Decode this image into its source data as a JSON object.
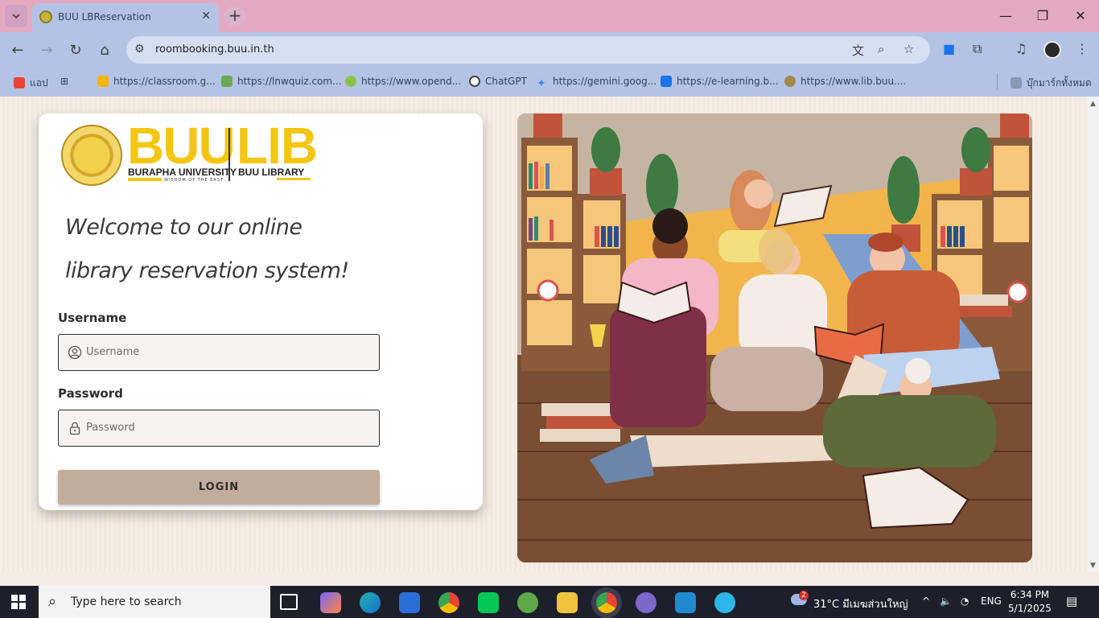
{
  "browser": {
    "tab_title": "BUU LBReservation",
    "url": "roombooking.buu.in.th",
    "bookmarks": [
      {
        "label": "แอป",
        "icon": "apps-icon",
        "color": "#ea4335"
      },
      {
        "label": "https://classroom.g...",
        "icon": "classroom-icon",
        "color": "#f4b400"
      },
      {
        "label": "https://lnwquiz.com...",
        "icon": "lnwquiz-icon",
        "color": "#6aa84f"
      },
      {
        "label": "https://www.opend...",
        "icon": "opend-icon",
        "color": "#8bc34a"
      },
      {
        "label": "ChatGPT",
        "icon": "chatgpt-icon",
        "color": "#444444"
      },
      {
        "label": "https://gemini.goog...",
        "icon": "gemini-icon",
        "color": "#4285f4"
      },
      {
        "label": "https://e-learning.b...",
        "icon": "elearning-icon",
        "color": "#1a73e8"
      },
      {
        "label": "https://www.lib.buu....",
        "icon": "lib-icon",
        "color": "#9e8a4a"
      }
    ],
    "all_bookmarks_label": "บุ๊กมาร์กทั้งหมด"
  },
  "login": {
    "logo_buu": "BUU",
    "logo_buu_sub": "BURAPHA UNIVERSITY",
    "logo_buu_motto": "WISDOM OF THE EAST",
    "logo_lib": "LIB",
    "logo_lib_sub": "BUU LIBRARY",
    "welcome_line1": "Welcome to our online",
    "welcome_line2": "library reservation system!",
    "username_label": "Username",
    "username_placeholder": "Username",
    "password_label": "Password",
    "password_placeholder": "Password",
    "login_button": "LOGIN"
  },
  "taskbar": {
    "search_placeholder": "Type here to search",
    "weather": "31°C  มีเมฆส่วนใหญ่",
    "weather_badge": "2",
    "language": "ENG",
    "time": "6:34 PM",
    "date": "5/1/2025"
  },
  "colors": {
    "tabbar": "#e3a9c3",
    "toolbar": "#b4c3e4",
    "brand_yellow": "#f4c614",
    "login_button": "#c2ac9c"
  }
}
